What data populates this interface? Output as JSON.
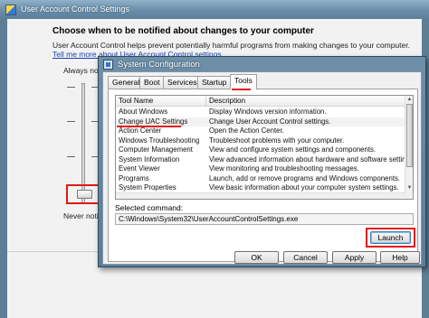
{
  "uac": {
    "title": "User Account Control Settings",
    "heading": "Choose when to be notified about changes to your computer",
    "description": "User Account Control helps prevent potentially harmful programs from making changes to your computer.",
    "link": "Tell me more about User Account Control settings",
    "always_label": "Always notif",
    "never_label": "Never notify"
  },
  "sysconfig": {
    "title": "System Configuration",
    "tabs": [
      {
        "label": "General"
      },
      {
        "label": "Boot"
      },
      {
        "label": "Services"
      },
      {
        "label": "Startup"
      },
      {
        "label": "Tools"
      }
    ],
    "active_tab": "Tools",
    "list": {
      "columns": [
        "Tool Name",
        "Description"
      ],
      "rows": [
        {
          "name": "About Windows",
          "desc": "Display Windows version information."
        },
        {
          "name": "Change UAC Settings",
          "desc": "Change User Account Control settings."
        },
        {
          "name": "Action Center",
          "desc": "Open the Action Center."
        },
        {
          "name": "Windows Troubleshooting",
          "desc": "Troubleshoot problems with your computer."
        },
        {
          "name": "Computer Management",
          "desc": "View and configure system settings and components."
        },
        {
          "name": "System Information",
          "desc": "View advanced information about hardware and software settings."
        },
        {
          "name": "Event Viewer",
          "desc": "View monitoring and troubleshooting messages."
        },
        {
          "name": "Programs",
          "desc": "Launch, add or remove programs and Windows components."
        },
        {
          "name": "System Properties",
          "desc": "View basic information about your computer system settings."
        }
      ]
    },
    "selected_command_label": "Selected command:",
    "selected_command": "C:\\Windows\\System32\\UserAccountControlSettings.exe",
    "launch_label": "Launch",
    "buttons": {
      "ok": "OK",
      "cancel": "Cancel",
      "apply": "Apply",
      "help": "Help"
    }
  },
  "colors": {
    "highlight": "#e01818"
  }
}
